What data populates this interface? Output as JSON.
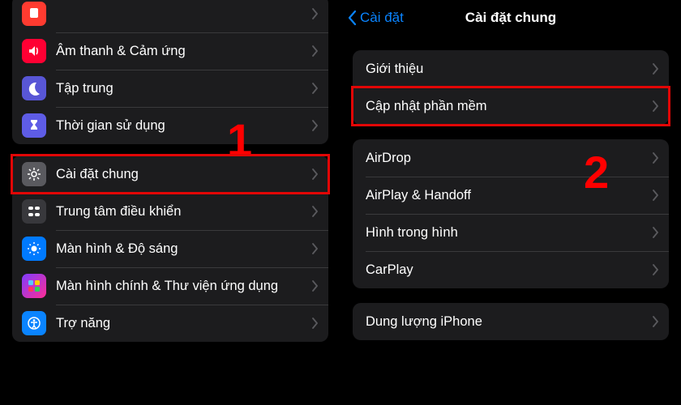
{
  "annotations": {
    "step1": "1",
    "step2": "2"
  },
  "left": {
    "group1": [
      {
        "bg": "ic-orange",
        "icon": "notification",
        "label": " "
      },
      {
        "bg": "ic-red",
        "icon": "sound",
        "label": "Âm thanh & Cảm ứng"
      },
      {
        "bg": "ic-indigo",
        "icon": "moon",
        "label": "Tập trung"
      },
      {
        "bg": "ic-hour",
        "icon": "hourglass",
        "label": "Thời gian sử dụng"
      }
    ],
    "group2": [
      {
        "bg": "ic-grey",
        "icon": "gear",
        "label": "Cài đặt chung",
        "highlight": true
      },
      {
        "bg": "ic-darkg",
        "icon": "controls",
        "label": "Trung tâm điều khiển"
      },
      {
        "bg": "ic-blue",
        "icon": "brightness",
        "label": "Màn hình & Độ sáng"
      },
      {
        "bg": "ic-purple",
        "icon": "apps",
        "label": "Màn hình chính & Thư viện ứng dụng"
      },
      {
        "bg": "ic-access",
        "icon": "access",
        "label": "Trợ năng"
      }
    ]
  },
  "right": {
    "back_label": "Cài đặt",
    "title": "Cài đặt chung",
    "group1": [
      {
        "label": "Giới thiệu"
      },
      {
        "label": "Cập nhật phần mềm",
        "highlight": true
      }
    ],
    "group2": [
      {
        "label": "AirDrop"
      },
      {
        "label": "AirPlay & Handoff"
      },
      {
        "label": "Hình trong hình"
      },
      {
        "label": "CarPlay"
      }
    ],
    "group3": [
      {
        "label": "Dung lượng iPhone"
      }
    ]
  }
}
